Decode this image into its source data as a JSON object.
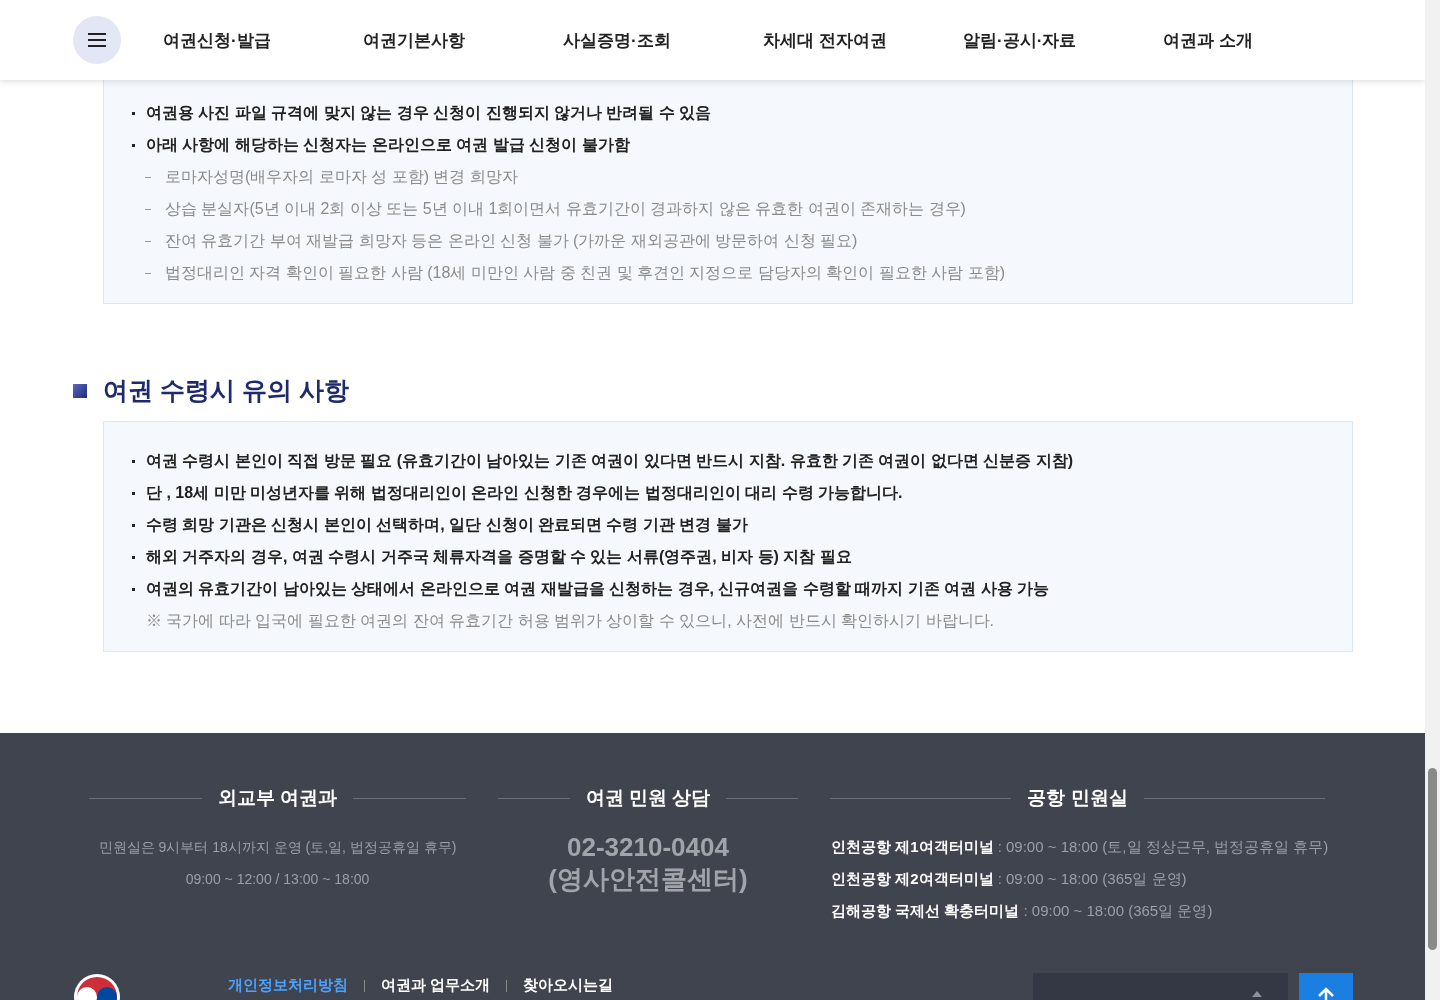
{
  "nav": {
    "items": [
      "여권신청·발급",
      "여권기본사항",
      "사실증명·조회",
      "차세대 전자여권",
      "알림·공시·자료",
      "여권과 소개"
    ]
  },
  "notice_box": {
    "items": [
      {
        "kind": "bullet",
        "text": "여권용 사진 파일 규격에 맞지 않는 경우 신청이 진행되지 않거나 반려될 수 있음"
      },
      {
        "kind": "bullet",
        "text": "아래 사항에 해당하는 신청자는 온라인으로 여권 발급 신청이 불가함"
      },
      {
        "kind": "dash",
        "text": "로마자성명(배우자의 로마자 성 포함) 변경 희망자"
      },
      {
        "kind": "dash",
        "text": "상습 분실자(5년 이내 2회 이상 또는 5년 이내 1회이면서 유효기간이 경과하지 않은 유효한 여권이 존재하는 경우)"
      },
      {
        "kind": "dash",
        "text": "잔여 유효기간 부여 재발급 희망자 등은 온라인 신청 불가 (가까운 재외공관에 방문하여 신청 필요)"
      },
      {
        "kind": "dash",
        "text": "법정대리인 자격 확인이 필요한 사람 (18세 미만인 사람 중 친권 및 후견인 지정으로 담당자의 확인이 필요한 사람 포함)"
      }
    ]
  },
  "section": {
    "title": "여권 수령시 유의 사항",
    "items": [
      {
        "kind": "bullet",
        "text": "여권 수령시 본인이 직접 방문 필요 (유효기간이 남아있는 기존 여권이 있다면 반드시 지참. 유효한 기존 여권이 없다면 신분증 지참)"
      },
      {
        "kind": "bullet",
        "text": "단 , 18세 미만 미성년자를 위해 법정대리인이 온라인 신청한 경우에는 법정대리인이 대리 수령 가능합니다."
      },
      {
        "kind": "bullet",
        "text": "수령 희망 기관은 신청시 본인이 선택하며, 일단 신청이 완료되면 수령 기관 변경 불가"
      },
      {
        "kind": "bullet",
        "text": "해외 거주자의 경우, 여권 수령시 거주국 체류자격을 증명할 수 있는 서류(영주권, 비자 등) 지참 필요"
      },
      {
        "kind": "bullet",
        "text": "여권의 유효기간이 남아있는 상태에서 온라인으로 여권 재발급을 신청하는 경우, 신규여권을 수령할 때까지 기존 여권 사용 가능"
      },
      {
        "kind": "note",
        "text": "※ 국가에 따라 입국에 필요한 여권의 잔여 유효기간 허용 범위가 상이할 수 있으니, 사전에 반드시 확인하시기 바랍니다."
      }
    ]
  },
  "footer": {
    "office": {
      "title": "외교부 여권과",
      "lines": [
        "민원실은 9시부터 18시까지 운영 (토,일, 법정공휴일 휴무)",
        "09:00 ~ 12:00 / 13:00 ~ 18:00"
      ]
    },
    "hotline": {
      "title": "여권 민원 상담",
      "phone": "02-3210-0404",
      "name": "(영사안전콜센터)"
    },
    "airport": {
      "title": "공항 민원실",
      "lines": [
        {
          "label": "인천공항 제1여객터미널",
          "value": ": 09:00 ~ 18:00 (토,일 정상근무, 법정공휴일 휴무)"
        },
        {
          "label": "인천공항 제2여객터미널",
          "value": ": 09:00 ~ 18:00 (365일 운영)"
        },
        {
          "label": "김해공항 국제선 확충터미널",
          "value": ": 09:00 ~ 18:00 (365일 운영)"
        }
      ]
    },
    "links": [
      {
        "label": "개인정보처리방침",
        "kind": "emphasis"
      },
      {
        "label": "여권과 업무소개",
        "kind": "plain"
      },
      {
        "label": "찾아오시는길",
        "kind": "plain"
      }
    ]
  }
}
